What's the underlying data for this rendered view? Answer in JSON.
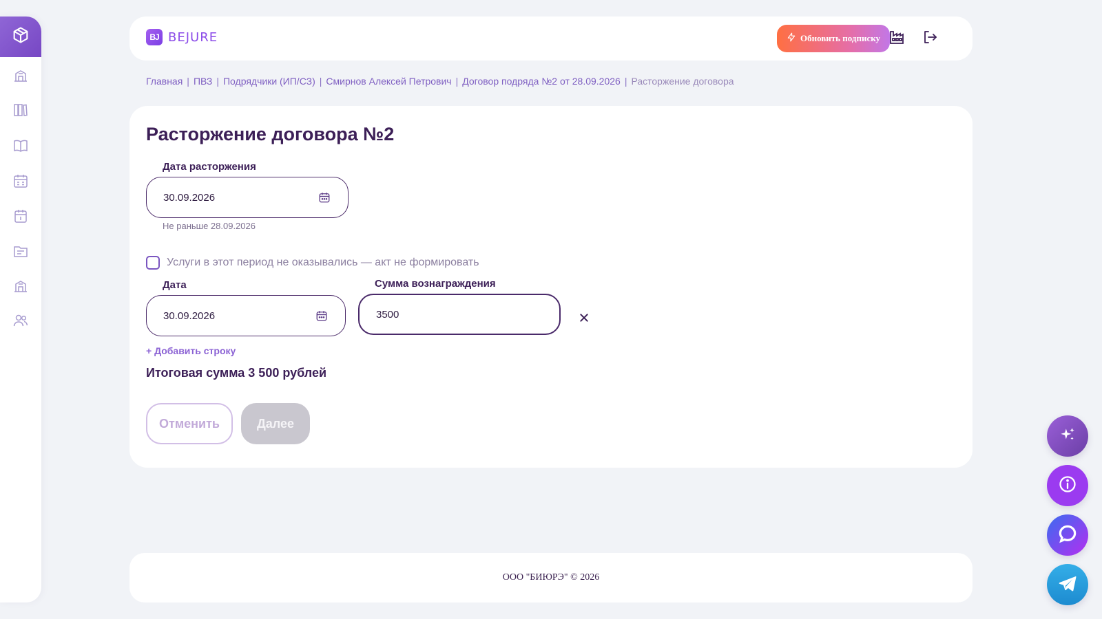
{
  "brand": {
    "mark": "BJ",
    "name": "BEJURE"
  },
  "header": {
    "upgrade_label": "Обновить подписку"
  },
  "breadcrumb": [
    "Главная",
    "ПВЗ",
    "Подрядчики (ИП/СЗ)",
    "Смирнов Алексей Петрович",
    "Договор подряда №2 от 28.09.2026",
    "Расторжение договора"
  ],
  "form": {
    "title": "Расторжение договора №2",
    "termination_date": {
      "label": "Дата расторжения",
      "value": "30.09.2026",
      "hint": "Не раньше 28.09.2026"
    },
    "no_services": {
      "label": "Услуги в этот период не оказывались — акт не формировать",
      "checked": false
    },
    "rows": [
      {
        "date_label": "Дата",
        "date_value": "30.09.2026",
        "amount_label": "Сумма вознаграждения",
        "amount_value": "3500"
      }
    ],
    "add_row_label": "+ Добавить строку",
    "total": "Итоговая сумма 3 500 рублей",
    "cancel_label": "Отменить",
    "next_label": "Далее"
  },
  "footer": {
    "text": "ООО \"БИЮРЭ\" © 2026"
  },
  "sidebar_icons": [
    "box-icon",
    "building-icon",
    "books-icon",
    "book-open-icon",
    "calendar-grid-icon",
    "calendar-icon",
    "folder-icon",
    "building-icon",
    "users-icon"
  ],
  "floating_buttons": [
    "sparkles-icon",
    "info-icon",
    "chat-icon",
    "telegram-icon"
  ],
  "colors": {
    "accent": "#8b4be8",
    "title": "#3c1f57",
    "upgrade_gradient_start": "#ff6f42",
    "upgrade_gradient_end": "#c277e6",
    "disabled_button": "#c9c7cf"
  }
}
